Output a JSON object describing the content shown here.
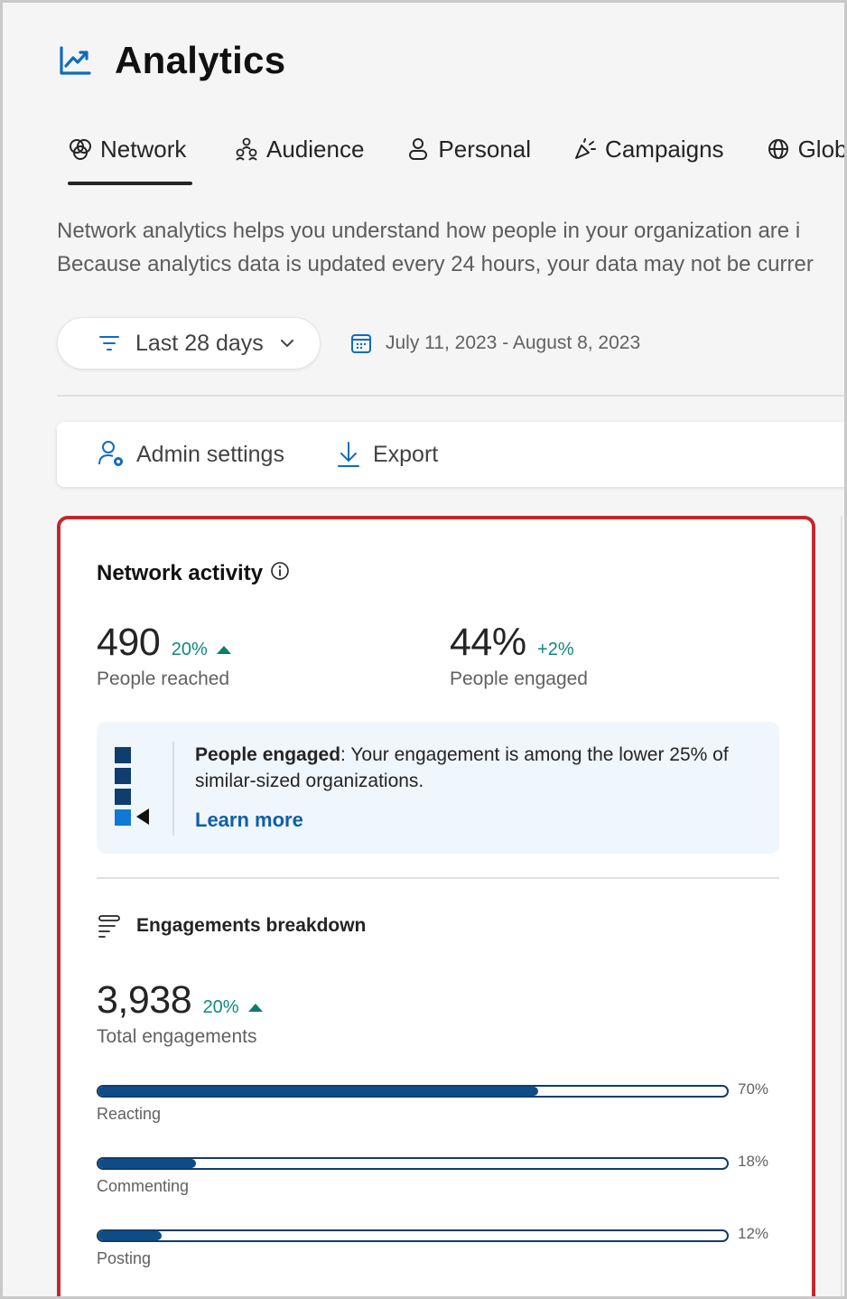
{
  "page": {
    "title": "Analytics",
    "icon": "trending-line-icon"
  },
  "tabs": [
    {
      "label": "Network",
      "icon": "network-icon",
      "active": true
    },
    {
      "label": "Audience",
      "icon": "people-group-icon",
      "active": false
    },
    {
      "label": "Personal",
      "icon": "person-icon",
      "active": false
    },
    {
      "label": "Campaigns",
      "icon": "megaphone-icon",
      "active": false
    },
    {
      "label": "Global",
      "icon": "globe-icon",
      "active": false
    }
  ],
  "description": {
    "line1": "Network analytics helps you understand how people in your organization are i",
    "line2": "Because analytics data is updated every 24 hours, your data may not be currer"
  },
  "filter": {
    "label": "Last 28 days",
    "date_range": "July 11, 2023 - August 8, 2023"
  },
  "toolbar": {
    "admin_settings": "Admin settings",
    "export": "Export"
  },
  "network_activity": {
    "title": "Network activity",
    "people_reached": {
      "value": "490",
      "delta": "20%",
      "label": "People reached",
      "trend": "up"
    },
    "people_engaged": {
      "value": "44%",
      "delta": "+2%",
      "label": "People engaged"
    },
    "insight": {
      "bold": "People engaged",
      "text": ": Your engagement is among the lower 25% of similar-sized organizations.",
      "link": "Learn more",
      "quartile_level": 4,
      "quartile_total": 4
    },
    "breakdown": {
      "title": "Engagements breakdown",
      "total": {
        "value": "3,938",
        "delta": "20%",
        "label": "Total engagements",
        "trend": "up"
      },
      "items": [
        {
          "label": "Reacting",
          "percent_label": "70%",
          "fraction": 0.7
        },
        {
          "label": "Commenting",
          "percent_label": "18%",
          "fraction": 0.155
        },
        {
          "label": "Posting",
          "percent_label": "12%",
          "fraction": 0.1
        }
      ]
    }
  },
  "colors": {
    "accent": "#0f6cbd",
    "bar_fill": "#0f4c86",
    "delta_green": "#0f8a7a",
    "highlight_border": "#c4262e",
    "link": "#0f5fa6"
  }
}
